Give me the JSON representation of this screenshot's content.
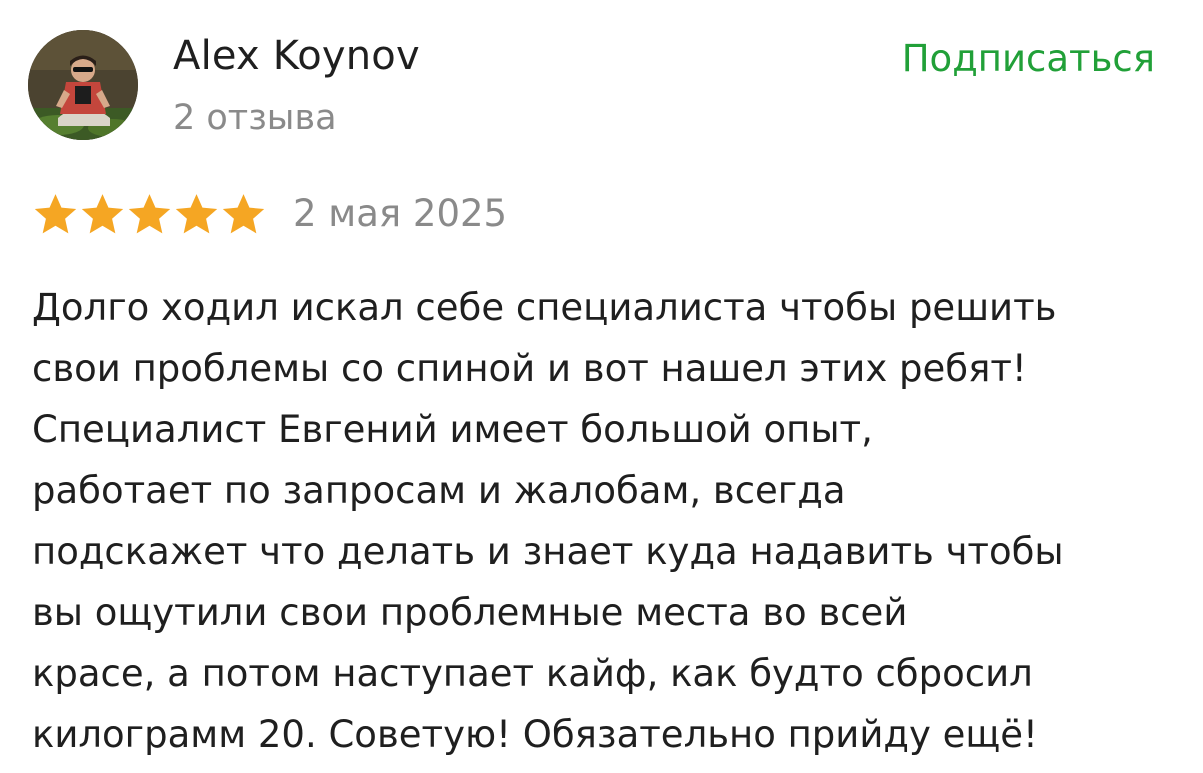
{
  "author": {
    "name": "Alex Koynov",
    "reviews_count": "2 отзыва",
    "avatar_icon": "user-avatar-photo"
  },
  "subscribe_label": "Подписаться",
  "rating": {
    "value": 5,
    "max": 5,
    "star_color": "#f5a623"
  },
  "review_date": "2 мая 2025",
  "review_text_lines": [
    "Долго ходил искал себе специалиста чтобы решить",
    "свои проблемы со спиной и вот нашел этих ребят!",
    "Специалист Евгений имеет большой опыт,",
    "работает по запросам и жалобам, всегда",
    "подскажет что делать и знает куда надавить чтобы",
    "вы ощутили свои проблемные места во всей",
    "красе, а потом наступает кайф, как будто сбросил",
    "килограмм 20. Советую! Обязательно прийду ещё!"
  ],
  "colors": {
    "accent_green": "#21a038",
    "muted_text": "#8a8a8a",
    "primary_text": "#1f1f1f"
  }
}
